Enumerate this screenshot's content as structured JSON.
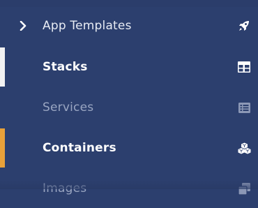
{
  "colors": {
    "background": "#2c3f6e",
    "text_primary": "#e8ecf4",
    "text_muted": "#9aa6c2",
    "icon_primary": "#ffffff",
    "icon_muted": "#8c98b6",
    "active_bar_white": "#f2f2f2",
    "active_bar_orange": "#e8a13a"
  },
  "sidebar": {
    "items": [
      {
        "label": "App Templates",
        "icon": "rocket-icon",
        "expandable": true
      },
      {
        "label": "Stacks",
        "icon": "table-icon"
      },
      {
        "label": "Services",
        "icon": "list-icon"
      },
      {
        "label": "Containers",
        "icon": "cubes-icon"
      },
      {
        "label": "Images",
        "icon": "clone-icon"
      }
    ]
  }
}
